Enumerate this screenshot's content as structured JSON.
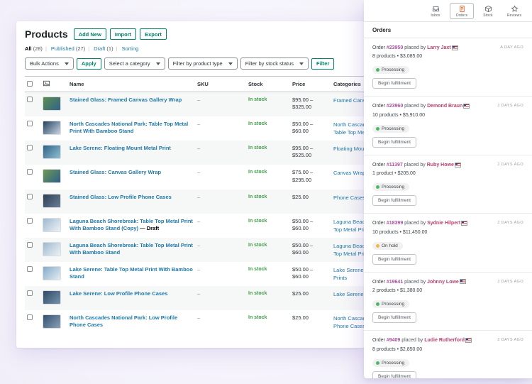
{
  "colors": {
    "button_accent": "#00836d",
    "link_blue": "#1f78a8",
    "stock_green": "#3f9c46",
    "order_number_link": "#a7529b",
    "customer_link": "#b7416e",
    "processing_dot": "#4ab866",
    "on_hold_dot": "#f0b849",
    "active_tab_icon": "#e2652e"
  },
  "products_page": {
    "title": "Products",
    "header_buttons": [
      {
        "label": "Add New"
      },
      {
        "label": "Import"
      },
      {
        "label": "Export"
      }
    ],
    "views": [
      {
        "label": "All",
        "count": "(28)"
      },
      {
        "label": "Published",
        "count": "(27)"
      },
      {
        "label": "Draft",
        "count": "(1)"
      },
      {
        "label": "Sorting",
        "count": ""
      }
    ],
    "filters": {
      "bulk_actions": "Bulk Actions",
      "apply_label": "Apply",
      "category": "Select a category",
      "product_type": "Filter by product type",
      "stock_status": "Filter by stock status",
      "filter_label": "Filter"
    },
    "table": {
      "headers": {
        "name": "Name",
        "sku": "SKU",
        "stock": "Stock",
        "price": "Price",
        "categories": "Categories"
      },
      "rows": [
        {
          "name": "Stained Glass: Framed Canvas Gallery Wrap",
          "sku": "–",
          "stock": "In stock",
          "price": "$95.00 – $325.00",
          "categories": "Framed Canvas, Stained Glass",
          "thumb": [
            "#5d8f4e",
            "#31628c"
          ]
        },
        {
          "name": "North Cascades National Park: Table Top Metal Print With Bamboo Stand",
          "sku": "–",
          "stock": "In stock",
          "price": "$50.00 – $60.00",
          "categories": "North Cascades National Park, Table Top Metal Prints",
          "thumb": [
            "#24425f",
            "#c9d6e2"
          ]
        },
        {
          "name": "Lake Serene: Floating Mount Metal Print",
          "sku": "–",
          "stock": "In stock",
          "price": "$95.00 – $525.00",
          "categories": "Floating Mount, Lake Serene",
          "thumb": [
            "#2f6384",
            "#8fc0d6"
          ]
        },
        {
          "name": "Stained Glass: Canvas Gallery Wrap",
          "sku": "–",
          "stock": "In stock",
          "price": "$75.00 – $295.00",
          "categories": "Canvas Wraps, Stained Glass",
          "thumb": [
            "#6f9a52",
            "#2e5f8a"
          ]
        },
        {
          "name": "Stained Glass: Low Profile Phone Cases",
          "sku": "–",
          "stock": "In stock",
          "price": "$25.00",
          "categories": "Phone Cases, Stained Glass",
          "thumb": [
            "#2e3f55",
            "#6b7f96"
          ]
        },
        {
          "name": "Laguna Beach Shorebreak: Table Top Metal Print With Bamboo Stand (Copy)",
          "state": "— Draft",
          "sku": "–",
          "stock": "In stock",
          "price": "$50.00 – $60.00",
          "categories": "Laguna Beach Shorebreak, Table Top Metal Prints",
          "thumb": [
            "#9db9cf",
            "#eef2f6"
          ]
        },
        {
          "name": "Laguna Beach Shorebreak: Table Top Metal Print With Bamboo Stand",
          "sku": "–",
          "stock": "In stock",
          "price": "$50.00 – $60.00",
          "categories": "Laguna Beach Shorebreak, Table Top Metal Prints",
          "thumb": [
            "#9db9cf",
            "#eef2f6"
          ]
        },
        {
          "name": "Lake Serene: Table Top Metal Print With Bamboo Stand",
          "sku": "–",
          "stock": "In stock",
          "price": "$50.00 – $60.00",
          "categories": "Lake Serene, Table Top Metal Prints",
          "thumb": [
            "#86abc8",
            "#e3ecf3"
          ]
        },
        {
          "name": "Lake Serene: Low Profile Phone Cases",
          "sku": "–",
          "stock": "In stock",
          "price": "$25.00",
          "categories": "Lake Serene, Phone Cases",
          "thumb": [
            "#2e4a66",
            "#7792ab"
          ]
        },
        {
          "name": "North Cascades National Park: Low Profile Phone Cases",
          "sku": "–",
          "stock": "In stock",
          "price": "$25.00",
          "categories": "North Cascades National Park, Phone Cases",
          "thumb": [
            "#33506e",
            "#8aa2b8"
          ]
        }
      ]
    }
  },
  "activity_panel": {
    "tabs": [
      {
        "label": "Inbox"
      },
      {
        "label": "Orders"
      },
      {
        "label": "Stock"
      },
      {
        "label": "Reviews"
      }
    ],
    "active_tab": "Orders",
    "section_title": "Orders",
    "order_prefix": "Order",
    "orders": [
      {
        "number": "#23950",
        "placed_by": "placed by",
        "customer": "Larry Jaxt",
        "time": "A DAY AGO",
        "summary": "8 products • $3,085.00",
        "status": "Processing",
        "status_color": "#4ab866",
        "action": "Begin fulfillment"
      },
      {
        "number": "#23960",
        "placed_by": "placed by",
        "customer": "Demond Braun",
        "time": "2 DAYS AGO",
        "summary": "10 products • $5,910.00",
        "status": "Processing",
        "status_color": "#4ab866",
        "action": "Begin fulfillment"
      },
      {
        "number": "#11397",
        "placed_by": "placed by",
        "customer": "Ruby Howe",
        "time": "2 DAYS AGO",
        "summary": "1 product • $205.00",
        "status": "Processing",
        "status_color": "#4ab866",
        "action": "Begin fulfillment"
      },
      {
        "number": "#18399",
        "placed_by": "placed by",
        "customer": "Sydnie Hilpert",
        "time": "2 DAYS AGO",
        "summary": "10 products • $11,450.00",
        "status": "On hold",
        "status_color": "#f0b849",
        "action": "Begin fulfillment"
      },
      {
        "number": "#19641",
        "placed_by": "placed by",
        "customer": "Johnny Lowe",
        "time": "2 DAYS AGO",
        "summary": "2 products • $1,380.00",
        "status": "Processing",
        "status_color": "#4ab866",
        "action": "Begin fulfillment"
      },
      {
        "number": "#9409",
        "placed_by": "placed by",
        "customer": "Ludie Rutherford",
        "time": "2 DAYS AGO",
        "summary": "8 products • $2,850.00",
        "status": "Processing",
        "status_color": "#4ab866",
        "action": "Begin fulfillment"
      }
    ]
  }
}
